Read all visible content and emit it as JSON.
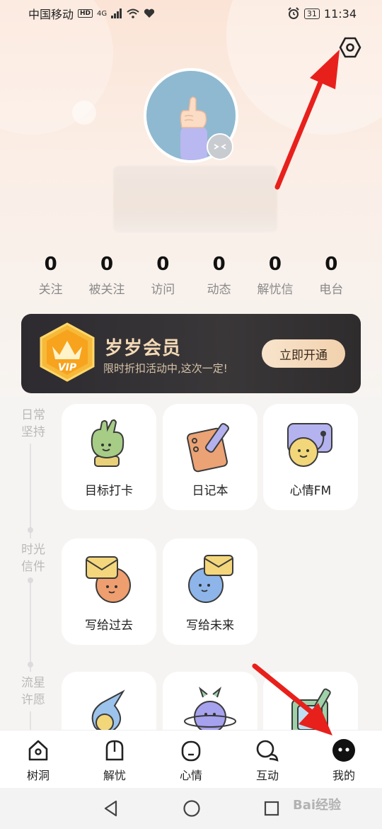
{
  "status_bar": {
    "carrier": "中国移动",
    "hd": "HD",
    "network": "4G",
    "battery": "31",
    "time": "11:34"
  },
  "profile": {
    "stats": [
      {
        "value": "0",
        "label": "关注"
      },
      {
        "value": "0",
        "label": "被关注"
      },
      {
        "value": "0",
        "label": "访问"
      },
      {
        "value": "0",
        "label": "动态"
      },
      {
        "value": "0",
        "label": "解忧信"
      },
      {
        "value": "0",
        "label": "电台"
      }
    ]
  },
  "vip": {
    "badge_text": "VIP",
    "title": "岁岁会员",
    "subtitle": "限时折扣活动中,这次一定!",
    "button": "立即开通"
  },
  "sections": [
    {
      "label": "日常坚持"
    },
    {
      "label": "时光信件"
    },
    {
      "label": "流星许愿"
    }
  ],
  "cards": {
    "daily": [
      "目标打卡",
      "日记本",
      "心情FM"
    ],
    "letters": [
      "写给过去",
      "写给未来"
    ]
  },
  "bottom_nav": [
    {
      "label": "树洞",
      "icon": "tree-hole-icon"
    },
    {
      "label": "解忧",
      "icon": "mailbox-icon"
    },
    {
      "label": "心情",
      "icon": "mood-icon"
    },
    {
      "label": "互动",
      "icon": "chat-icon"
    },
    {
      "label": "我的",
      "icon": "profile-face-icon",
      "active": true
    }
  ],
  "watermark": "Bai经验",
  "colors": {
    "vip_bg": "#2d2b30",
    "vip_gold": "#f3d9b6",
    "annotation_red": "#e8201c"
  }
}
